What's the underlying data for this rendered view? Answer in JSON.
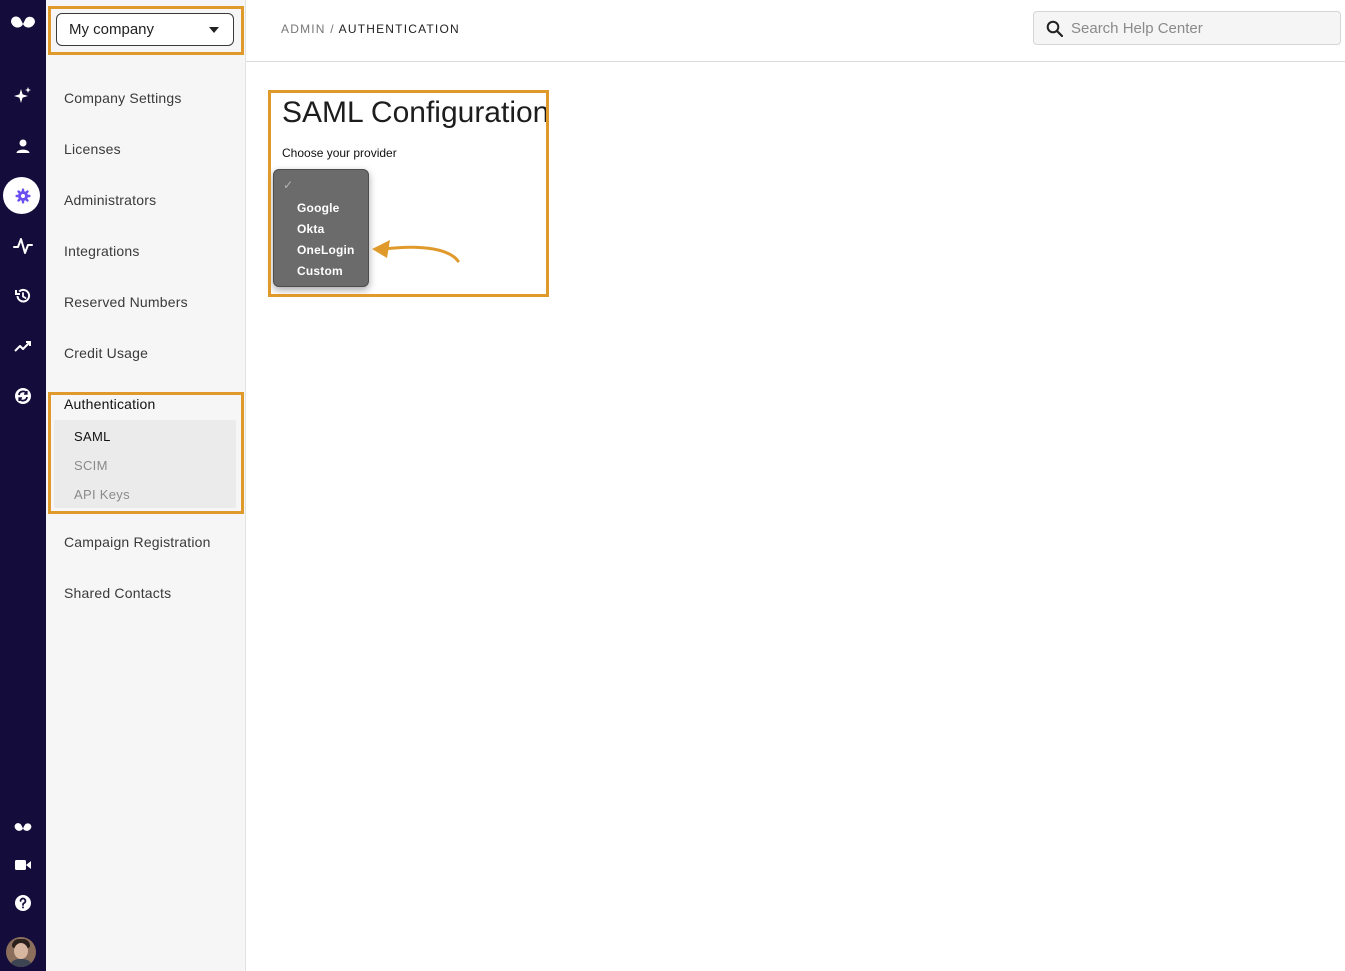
{
  "rail": {
    "icons": [
      "logo-icon",
      "sparkle-icon",
      "person-icon",
      "gear-icon",
      "activity-icon",
      "history-icon",
      "trending-icon",
      "sync-icon",
      "logo-small-icon",
      "video-icon",
      "help-icon",
      "avatar"
    ],
    "colors": {
      "background": "#140c3b",
      "active_icon": "#6b4ff0"
    }
  },
  "sidebar": {
    "company_select": "My company",
    "items": [
      {
        "label": "Company Settings"
      },
      {
        "label": "Licenses"
      },
      {
        "label": "Administrators"
      },
      {
        "label": "Integrations"
      },
      {
        "label": "Reserved Numbers"
      },
      {
        "label": "Credit Usage"
      }
    ],
    "auth": {
      "label": "Authentication",
      "sub": [
        {
          "label": "SAML",
          "active": true
        },
        {
          "label": "SCIM",
          "active": false
        },
        {
          "label": "API Keys",
          "active": false
        }
      ]
    },
    "items_after": [
      {
        "label": "Campaign Registration"
      },
      {
        "label": "Shared Contacts"
      }
    ]
  },
  "header": {
    "breadcrumb_root": "ADMIN",
    "breadcrumb_sep": " / ",
    "breadcrumb_current": "AUTHENTICATION",
    "search_placeholder": "Search Help Center"
  },
  "main": {
    "title": "SAML Configuration",
    "provider_label": "Choose your provider",
    "dropdown": {
      "checkmark": "✓",
      "options": [
        "Google",
        "Okta",
        "OneLogin",
        "Custom"
      ]
    }
  },
  "highlight_color": "#e09a2c"
}
